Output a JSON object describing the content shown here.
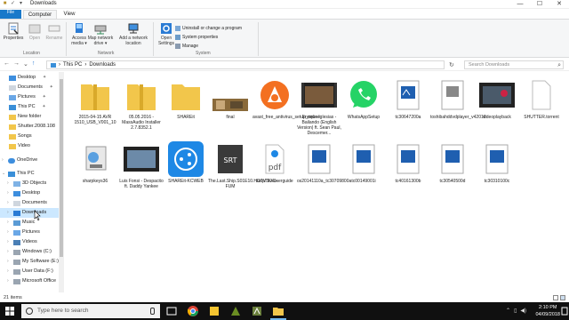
{
  "window": {
    "title": "Downloads",
    "controls": {
      "minimize": "—",
      "maximize": "☐",
      "close": "✕"
    }
  },
  "tabs": {
    "file": "File",
    "computer": "Computer",
    "view": "View"
  },
  "ribbon": {
    "location": {
      "label": "Location",
      "properties": "Properties",
      "open": "Open",
      "rename": "Rename"
    },
    "network": {
      "label": "Network",
      "access_media": "Access media ▾",
      "map_network_drive": "Map network drive ▾",
      "add_network_location": "Add a network location"
    },
    "system": {
      "label": "System",
      "open_settings": "Open Settings",
      "uninstall": "Uninstall or change a program",
      "system_properties": "System properties",
      "manage": "Manage"
    }
  },
  "address": {
    "crumbs": [
      "This PC",
      "Downloads"
    ],
    "separator": "›",
    "search_placeholder": "Search Downloads"
  },
  "nav_pane": {
    "quick": [
      "Desktop",
      "Documents",
      "Pictures",
      "This PC",
      "New folder",
      "Shutter.2008.108",
      "Songs",
      "Video"
    ],
    "onedrive": "OneDrive",
    "this_pc": "This PC",
    "pc_children": [
      "3D Objects",
      "Desktop",
      "Documents",
      "Downloads",
      "Music",
      "Pictures",
      "Videos",
      "Windows (C:)",
      "My Software (E:)",
      "User Data (F:)",
      "Microsoft Office"
    ]
  },
  "files": [
    {
      "name": "2015-04-15 AVR 1510_USB_V001_10",
      "kind": "folder-zip"
    },
    {
      "name": "05.05.2016 - MassAudio Installer 2.7.8352.1",
      "kind": "folder-zip"
    },
    {
      "name": "SHAREit",
      "kind": "folder"
    },
    {
      "name": "final",
      "kind": "image"
    },
    {
      "name": "avast_free_antivirus_setup_online",
      "kind": "avast"
    },
    {
      "name": "Enrique Iglesias - Bailando (English Version) ft. Sean Paul, Descemer...",
      "kind": "video"
    },
    {
      "name": "WhatsAppSetup",
      "kind": "whatsapp"
    },
    {
      "name": "tc30647200a",
      "kind": "doc"
    },
    {
      "name": "toshibahddvdplayer_v42016",
      "kind": "doc"
    },
    {
      "name": "videoplayback",
      "kind": "video"
    },
    {
      "name": "SHUTTER.torrent",
      "kind": "blank"
    },
    {
      "name": "sharpkeys36",
      "kind": "installer"
    },
    {
      "name": "Luis Fonsi - Despacito ft. Daddy Yankee",
      "kind": "video"
    },
    {
      "name": "SHAREit-KCWEB",
      "kind": "shareit"
    },
    {
      "name": "The.Last.Ship.S01E10.HDTV.XviD-FUM",
      "kind": "srt"
    },
    {
      "name": "satp750-userguide",
      "kind": "pdf"
    },
    {
      "name": "os20141110a_tc30709800a",
      "kind": "doc"
    },
    {
      "name": "tc00149001i",
      "kind": "doc"
    },
    {
      "name": "tc40161300b",
      "kind": "doc"
    },
    {
      "name": "tc30540500d",
      "kind": "doc"
    },
    {
      "name": "tc30310100c",
      "kind": "doc"
    }
  ],
  "status": {
    "items": "21 items"
  },
  "taskbar": {
    "search_placeholder": "Type here to search",
    "time": "2:10 PM",
    "date": "04/09/2018"
  },
  "colors": {
    "accent": "#1979ca",
    "folder": "#f2c64b",
    "selection": "#cce8ff",
    "taskbar": "#101010"
  }
}
